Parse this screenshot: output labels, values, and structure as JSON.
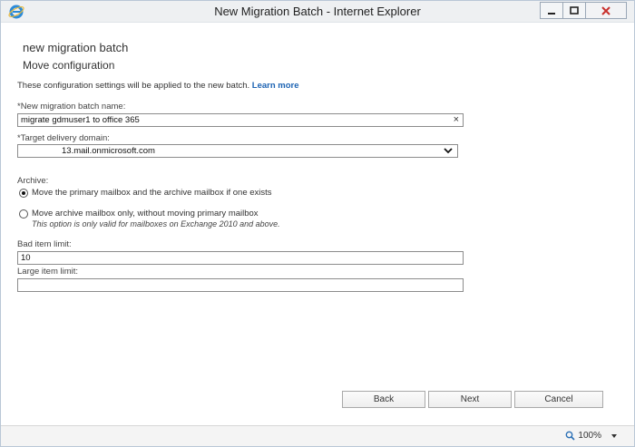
{
  "window": {
    "title": "New Migration Batch - Internet Explorer"
  },
  "page": {
    "heading": "new migration batch",
    "subheading": "Move configuration",
    "info_text": "These configuration settings will be applied to the new batch.",
    "learn_more": "Learn more"
  },
  "form": {
    "batch_name_label": "*New migration batch name:",
    "batch_name_value": "migrate gdmuser1 to office 365",
    "clear_symbol": "×",
    "target_domain_label": "*Target delivery domain:",
    "target_domain_value": "13.mail.onmicrosoft.com",
    "archive_label": "Archive:",
    "archive_options": [
      {
        "label": "Move the primary mailbox and the archive mailbox if one exists",
        "selected": true
      },
      {
        "label": "Move archive mailbox only, without moving primary mailbox",
        "note": "This option is only valid for mailboxes on Exchange 2010 and above.",
        "selected": false
      }
    ],
    "bad_item_label": "Bad item limit:",
    "bad_item_value": "10",
    "large_item_label": "Large item limit:",
    "large_item_value": ""
  },
  "buttons": {
    "back": "Back",
    "next": "Next",
    "cancel": "Cancel"
  },
  "status": {
    "zoom": "100%"
  },
  "colors": {
    "link": "#1c63b3",
    "close_x": "#c8302c"
  }
}
